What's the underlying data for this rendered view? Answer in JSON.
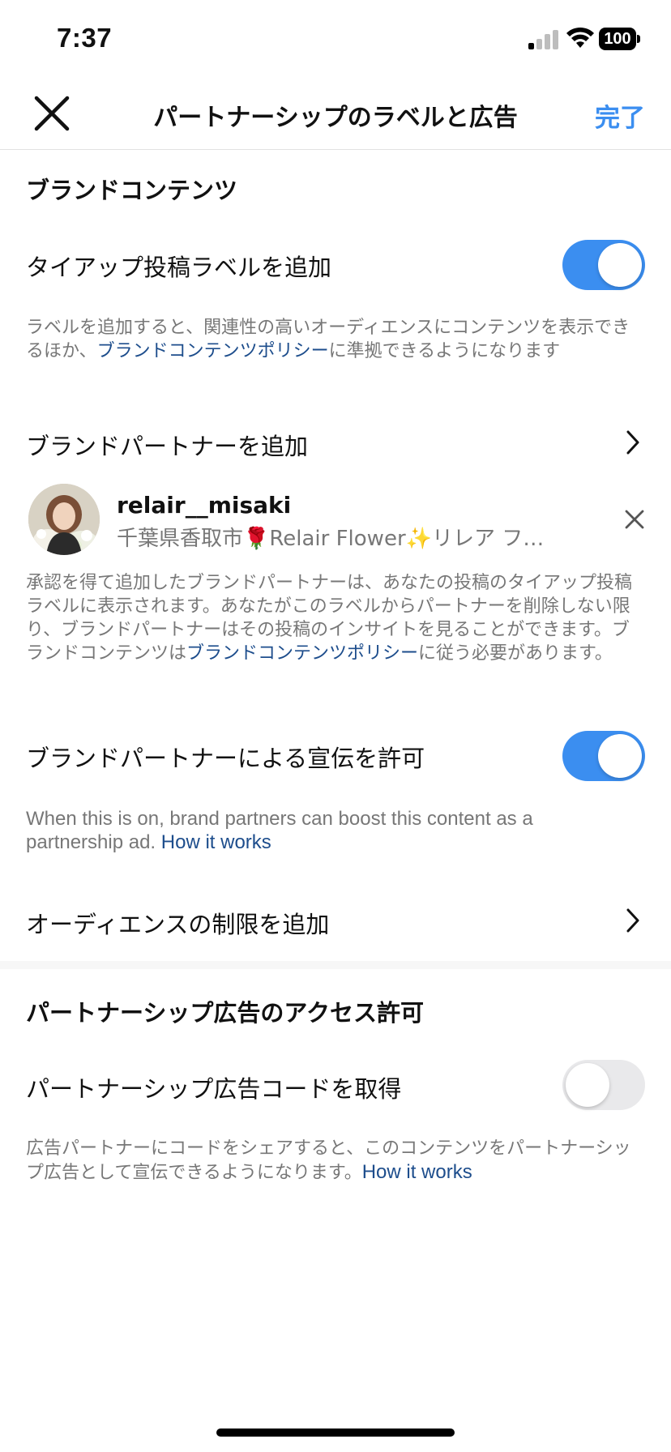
{
  "status_bar": {
    "time": "7:37",
    "battery": "100"
  },
  "header": {
    "title": "パートナーシップのラベルと広告",
    "done_label": "完了"
  },
  "branded_content": {
    "section_title": "ブランドコンテンツ",
    "paid_label_row": "タイアップ投稿ラベルを追加",
    "paid_label_on": true,
    "paid_label_desc_before": "ラベルを追加すると、関連性の高いオーディエンスにコンテンツを表示できるほか、",
    "paid_label_desc_link": "ブランドコンテンツポリシー",
    "paid_label_desc_after": "に準拠できるようになります",
    "add_partner_row": "ブランドパートナーを追加",
    "partner": {
      "username": "relair__misaki",
      "subtitle": "千葉県香取市🌹Relair Flower✨リレア フ…"
    },
    "partner_desc_before": "承認を得て追加したブランドパートナーは、あなたの投稿のタイアップ投稿ラベルに表示されます。あなたがこのラベルからパートナーを削除しない限り、ブランドパートナーはその投稿のインサイトを見ることができます。ブランドコンテンツは",
    "partner_desc_link": "ブランドコンテンツポリシー",
    "partner_desc_after": "に従う必要があります。",
    "allow_promote_row": "ブランドパートナーによる宣伝を許可",
    "allow_promote_on": true,
    "allow_promote_desc": "When this is on, brand partners can boost this content as a partnership ad. ",
    "allow_promote_link": "How it works",
    "audience_row": "オーディエンスの制限を追加"
  },
  "partnership_ads": {
    "section_title": "パートナーシップ広告のアクセス許可",
    "code_row": "パートナーシップ広告コードを取得",
    "code_on": false,
    "code_desc": "広告パートナーにコードをシェアすると、このコンテンツをパートナーシップ広告として宣伝できるようになります。",
    "code_link": "How it works"
  },
  "colors": {
    "accent": "#3b8ef0",
    "link": "#1d4d8c",
    "secondary_text": "#777777"
  }
}
